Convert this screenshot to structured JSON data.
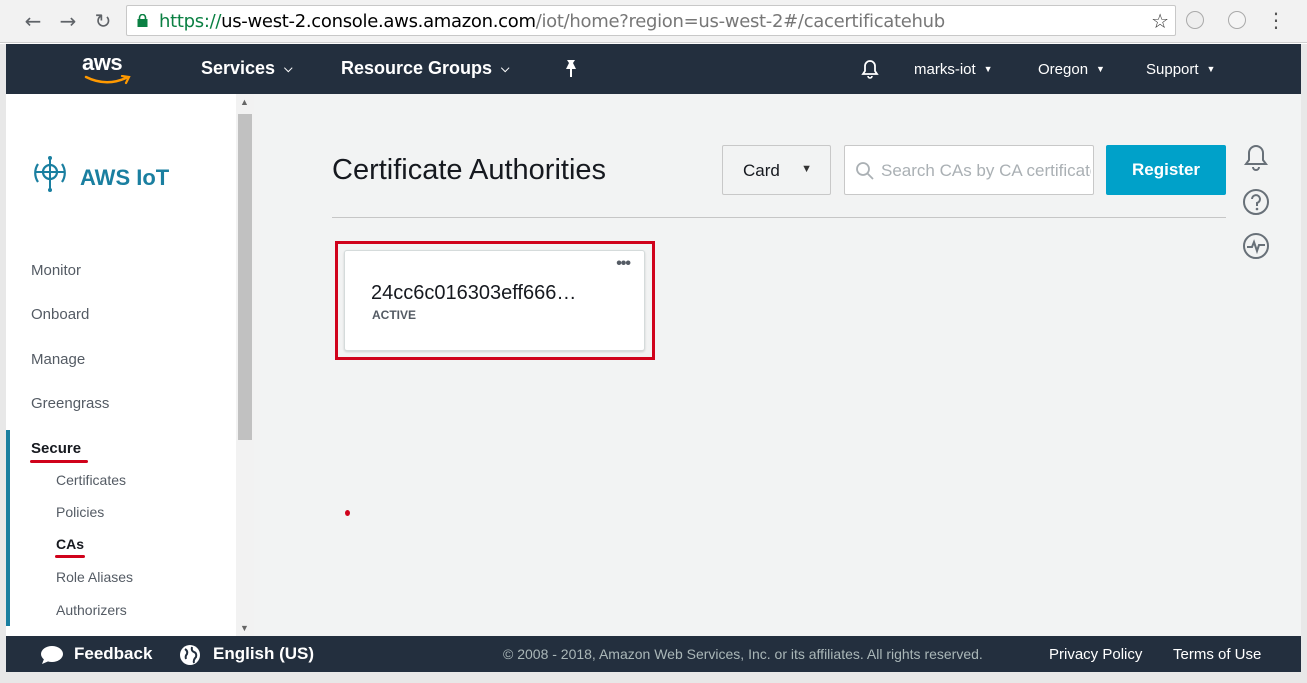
{
  "browser": {
    "url_scheme": "https://",
    "url_host": "us-west-2.console.aws.amazon.com",
    "url_path": "/iot/home?region=us-west-2#/cacertificatehub",
    "icons": [
      "back-icon",
      "forward-icon",
      "reload-icon",
      "lock-icon",
      "star-icon",
      "extension-icon",
      "menu-icon"
    ]
  },
  "aws_nav": {
    "logo": "aws",
    "services_label": "Services",
    "resource_groups_label": "Resource Groups",
    "account_label": "marks-iot",
    "region_label": "Oregon",
    "support_label": "Support"
  },
  "sidebar": {
    "service_title": "AWS IoT",
    "items": [
      {
        "label": "Monitor"
      },
      {
        "label": "Onboard"
      },
      {
        "label": "Manage"
      },
      {
        "label": "Greengrass"
      },
      {
        "label": "Secure"
      }
    ],
    "sub_items": [
      {
        "label": "Certificates"
      },
      {
        "label": "Policies"
      },
      {
        "label": "CAs"
      },
      {
        "label": "Role Aliases"
      },
      {
        "label": "Authorizers"
      }
    ],
    "active_item": "Secure",
    "active_sub_item": "CAs"
  },
  "main": {
    "title": "Certificate Authorities",
    "view_select_value": "Card",
    "search_placeholder": "Search CAs by CA certificate",
    "register_label": "Register",
    "ca_card": {
      "name": "24cc6c016303eff666…",
      "status": "ACTIVE",
      "menu_glyph": "•••"
    }
  },
  "footer": {
    "feedback_label": "Feedback",
    "language_label": "English (US)",
    "copyright": "© 2008 - 2018, Amazon Web Services, Inc. or its affiliates. All rights reserved.",
    "privacy_label": "Privacy Policy",
    "terms_label": "Terms of Use"
  },
  "colors": {
    "nav_bg": "#232f3e",
    "accent": "#00a1c9",
    "iot_blue": "#1a7fa0",
    "highlight_red": "#d0021b"
  }
}
